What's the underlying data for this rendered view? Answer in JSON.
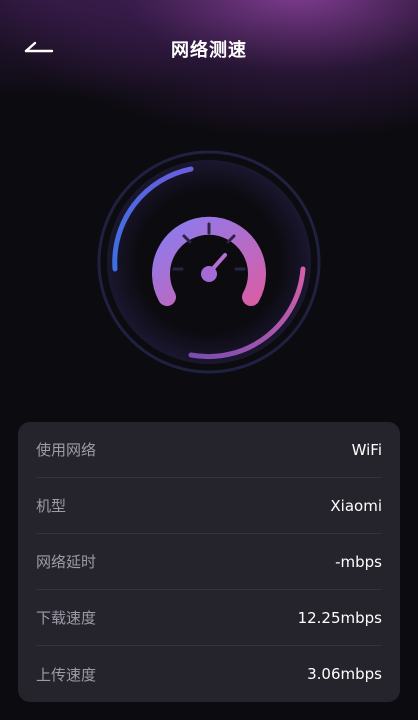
{
  "header": {
    "title": "网络测速",
    "back_icon": "back-arrow-icon"
  },
  "gauge": {
    "icon": "speedometer-icon",
    "colors": {
      "ring_blue": "#4f7fe8",
      "ring_pink": "#cc5aa8",
      "dial_start": "#8a7cf0",
      "dial_end": "#d65fa8"
    }
  },
  "info": {
    "rows": [
      {
        "label": "使用网络",
        "value": "WiFi"
      },
      {
        "label": "机型",
        "value": "Xiaomi"
      },
      {
        "label": "网络延时",
        "value": "-mbps"
      },
      {
        "label": "下载速度",
        "value": "12.25mbps"
      },
      {
        "label": "上传速度",
        "value": "3.06mbps"
      }
    ]
  },
  "colors": {
    "background": "#0c0b10",
    "card": "#25242d",
    "label_text": "#9d9ba6",
    "value_text": "#ffffff"
  }
}
